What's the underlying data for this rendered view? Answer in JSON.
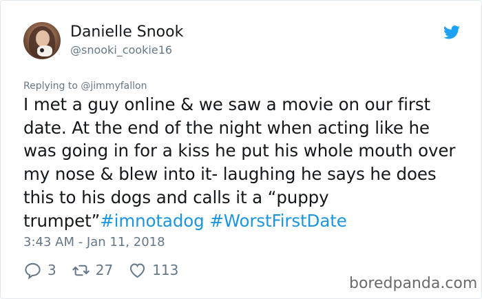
{
  "user": {
    "name": "Danielle Snook",
    "handle": "@snooki_cookie16"
  },
  "reply": {
    "prefix": "Replying to ",
    "mention": "@jimmyfallon"
  },
  "tweet": {
    "lines": [
      "I met a guy online & we saw a movie on our first",
      "date. At the end of the night when acting like he",
      "was going in for a kiss he put his whole mouth over",
      "my nose & blew into it- laughing he says he does",
      "this to his dogs and calls it a “puppy"
    ],
    "last_line_text": "trumpet”",
    "hashtags": [
      "#imnotadog",
      "#WorstFirstDate"
    ]
  },
  "timestamp": "3:43 AM - Jan 11, 2018",
  "actions": {
    "replies": "3",
    "retweets": "27",
    "likes": "113"
  },
  "icons": {
    "brand": "twitter-bird-icon",
    "reply": "reply-icon",
    "retweet": "retweet-icon",
    "like": "heart-icon"
  },
  "colors": {
    "brand_blue": "#1da1f2",
    "hashtag": "#1b95e0",
    "muted": "#657786",
    "text": "#14171a"
  },
  "watermark": "boredpanda.com"
}
